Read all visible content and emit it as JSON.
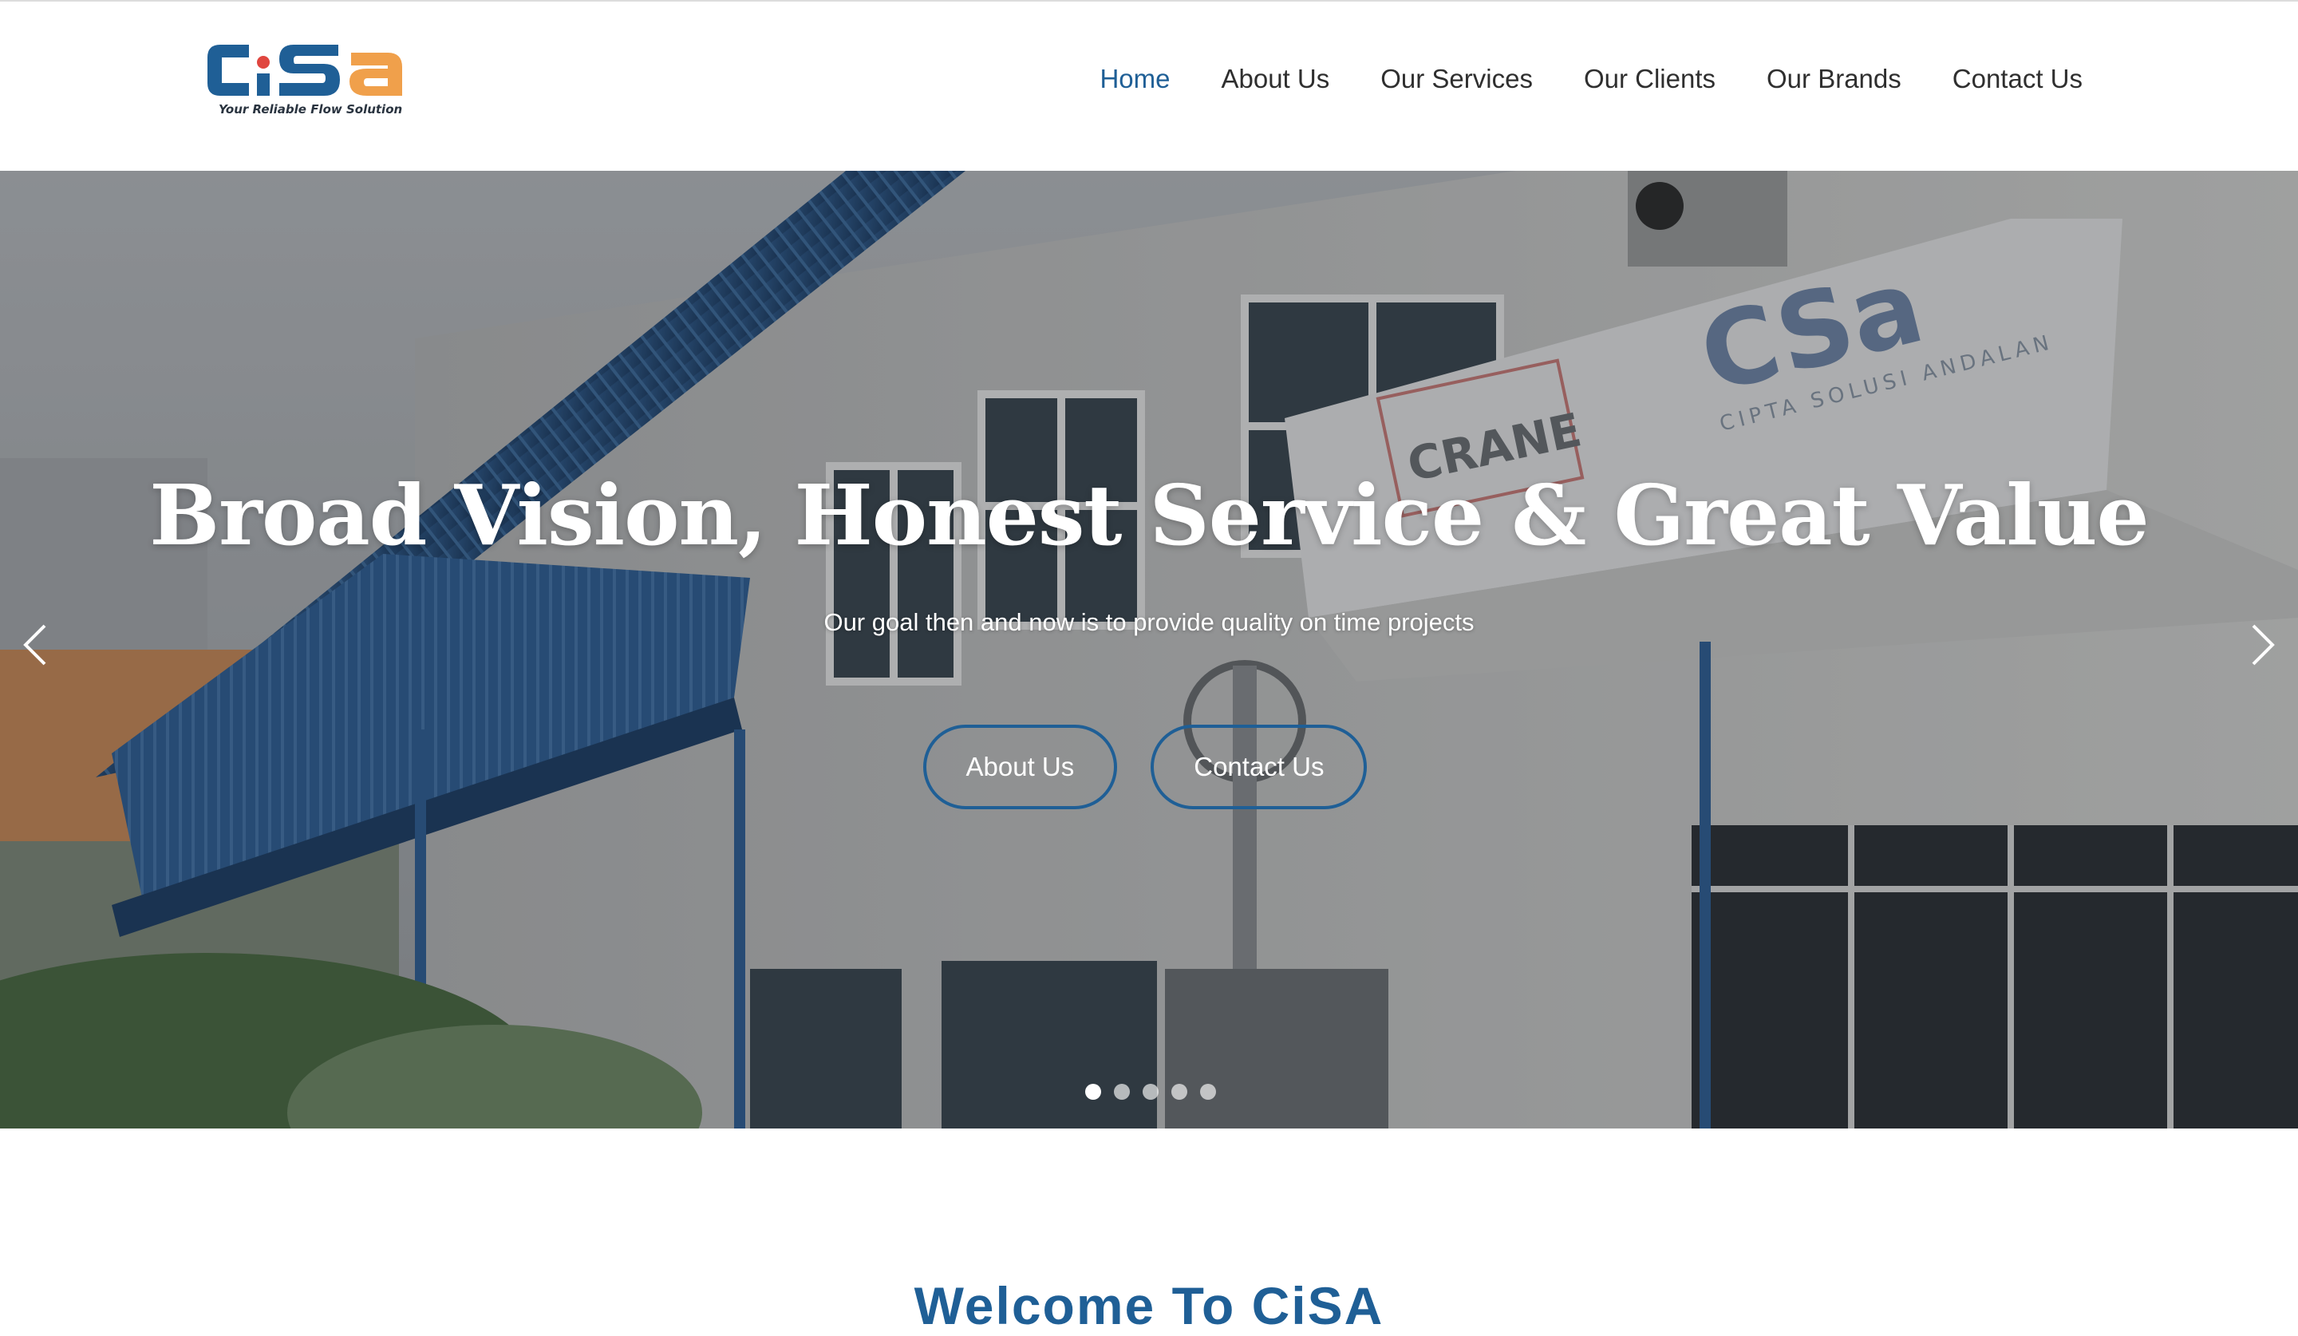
{
  "header": {
    "logo_text": "CSa",
    "logo_tagline": "Your Reliable Flow Solution",
    "nav": [
      {
        "label": "Home",
        "active": true
      },
      {
        "label": "About Us",
        "active": false
      },
      {
        "label": "Our Services",
        "active": false
      },
      {
        "label": "Our Clients",
        "active": false
      },
      {
        "label": "Our Brands",
        "active": false
      },
      {
        "label": "Contact Us",
        "active": false
      }
    ]
  },
  "hero": {
    "title": "Broad Vision, Honest Service & Great Value",
    "subtitle": "Our goal then and now is to provide quality on time projects",
    "buttons": [
      {
        "label": "About Us"
      },
      {
        "label": "Contact Us"
      }
    ],
    "slide_count": 5,
    "active_slide": 1,
    "photo_sign": {
      "brand": "CSa",
      "company": "CIPTA SOLUSI ANDALAN",
      "crane": "CRANE"
    }
  },
  "welcome": {
    "title": "Welcome To CiSA"
  },
  "colors": {
    "brand_blue": "#1f5f96",
    "brand_orange": "#f0a04b",
    "nav_text": "#2f2f2f"
  },
  "icons": {
    "prev": "chevron-left-icon",
    "next": "chevron-right-icon"
  }
}
